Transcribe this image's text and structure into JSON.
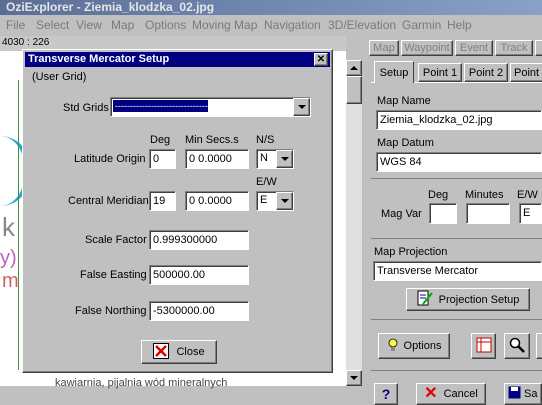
{
  "app": {
    "title": "OziExplorer - Ziemia_klodzka_02.jpg"
  },
  "menu": [
    "File",
    "Select",
    "View",
    "Map",
    "Options",
    "Moving Map",
    "Navigation",
    "3D/Elevation",
    "Garmin",
    "Help"
  ],
  "map_view": {
    "coord_readout": "4030 : 226",
    "bottom_text": "kawiarnia, pijalnia wód mineralnych",
    "fragment_letters": [
      "k",
      "y)",
      "m"
    ]
  },
  "dialog": {
    "title": "Transverse Mercator Setup",
    "subtitle": "(User Grid)",
    "std_grids_label": "Std Grids",
    "std_grids_value": "----------------------------------",
    "deg_header": "Deg",
    "min_secs_header": "Min Secs.s",
    "ns_header": "N/S",
    "ew_header": "E/W",
    "latitude_origin_label": "Latitude Origin",
    "latitude_deg": "0",
    "latitude_min": "0 0.0000",
    "latitude_ns": "N",
    "central_meridian_label": "Central Meridian",
    "meridian_deg": "19",
    "meridian_min": "0 0.0000",
    "meridian_ew": "E",
    "scale_factor_label": "Scale Factor",
    "scale_factor_value": "0.999300000",
    "false_easting_label": "False Easting",
    "false_easting_value": "500000.00",
    "false_northing_label": "False Northing",
    "false_northing_value": "-5300000.00",
    "close_label": "Close"
  },
  "right_panel": {
    "top_tabs": [
      "Map",
      "Waypoint",
      "Event",
      "Track"
    ],
    "tabs": [
      "Setup",
      "Point 1",
      "Point 2",
      "Point"
    ],
    "map_name_label": "Map Name",
    "map_name_value": "Ziemia_klodzka_02.jpg",
    "map_datum_label": "Map Datum",
    "map_datum_value": "WGS 84",
    "deg_header": "Deg",
    "minutes_header": "Minutes",
    "ew_header": "E/W",
    "mag_var_label": "Mag Var",
    "mag_var_ew": "E",
    "map_projection_label": "Map Projection",
    "map_projection_value": "Transverse Mercator",
    "projection_setup_label": "Projection Setup",
    "options_label": "Options",
    "help_label": "?",
    "cancel_label": "Cancel",
    "save_label": "Sa"
  }
}
